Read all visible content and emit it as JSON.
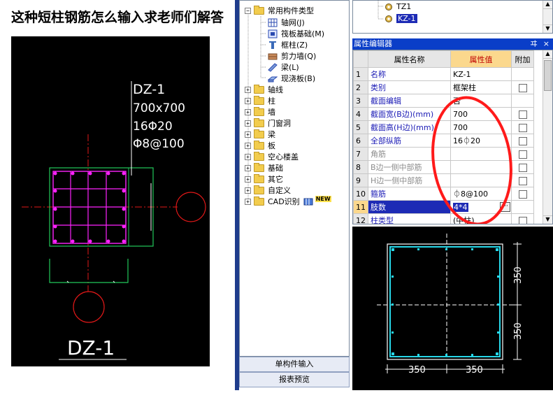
{
  "question": "这种短柱钢筋怎么输入求老师们解答",
  "cad_left": {
    "label_name": "DZ-1",
    "label_size": "700x700",
    "label_rebar": "16Φ20",
    "label_stirrup": "Φ8@100",
    "bottom_label": "DZ-1"
  },
  "tree": {
    "root": "常用构件类型",
    "children": [
      "轴网(J)",
      "筏板基础(M)",
      "框柱(Z)",
      "剪力墙(Q)",
      "梁(L)",
      "现浇板(B)"
    ],
    "groups": [
      "轴线",
      "柱",
      "墙",
      "门窗洞",
      "梁",
      "板",
      "空心楼盖",
      "基础",
      "其它",
      "自定义",
      "CAD识别"
    ],
    "new_badge": "NEW",
    "expand_minus": "−",
    "expand_plus": "+"
  },
  "buttons": {
    "single_input": "单构件输入",
    "report_preview": "报表预览"
  },
  "top_list": {
    "items": [
      "TZ1",
      "KZ-1"
    ],
    "selected": "KZ-1"
  },
  "property_editor": {
    "title": "属性编辑器",
    "pin": "ヰ",
    "close": "×",
    "headers": [
      "属性名称",
      "属性值",
      "附加"
    ],
    "rows": [
      {
        "idx": "1",
        "name": "名称",
        "value": "KZ-1"
      },
      {
        "idx": "2",
        "name": "类别",
        "value": "框架柱"
      },
      {
        "idx": "3",
        "name": "截面编辑",
        "value": "否"
      },
      {
        "idx": "4",
        "name": "截面宽(B边)(mm)",
        "value": "700"
      },
      {
        "idx": "5",
        "name": "截面高(H边)(mm)",
        "value": "700"
      },
      {
        "idx": "6",
        "name": "全部纵筋",
        "value": "16⏀20"
      },
      {
        "idx": "7",
        "name": "角筋",
        "value": ""
      },
      {
        "idx": "8",
        "name": "B边一侧中部筋",
        "value": ""
      },
      {
        "idx": "9",
        "name": "H边一侧中部筋",
        "value": ""
      },
      {
        "idx": "10",
        "name": "箍筋",
        "value": "⏀8@100"
      },
      {
        "idx": "11",
        "name": "肢数",
        "value": "4*4"
      },
      {
        "idx": "12",
        "name": "柱类型",
        "value": "(中柱)"
      }
    ],
    "ellipsis": "···"
  },
  "cad_right": {
    "dim_vertical_top": "350",
    "dim_vertical_bottom": "350",
    "dim_horizontal_left": "350",
    "dim_horizontal_right": "350"
  },
  "colors": {
    "cad_background": "#000000",
    "cad_green": "#22c85a",
    "cad_magenta": "#ff22ff",
    "cad_red": "#e01818",
    "cad_cyan": "#27d7e8",
    "title_bar": "#0a3ec8",
    "header_highlight": "#fbd88d",
    "annotation_red": "#ff1a1a"
  }
}
